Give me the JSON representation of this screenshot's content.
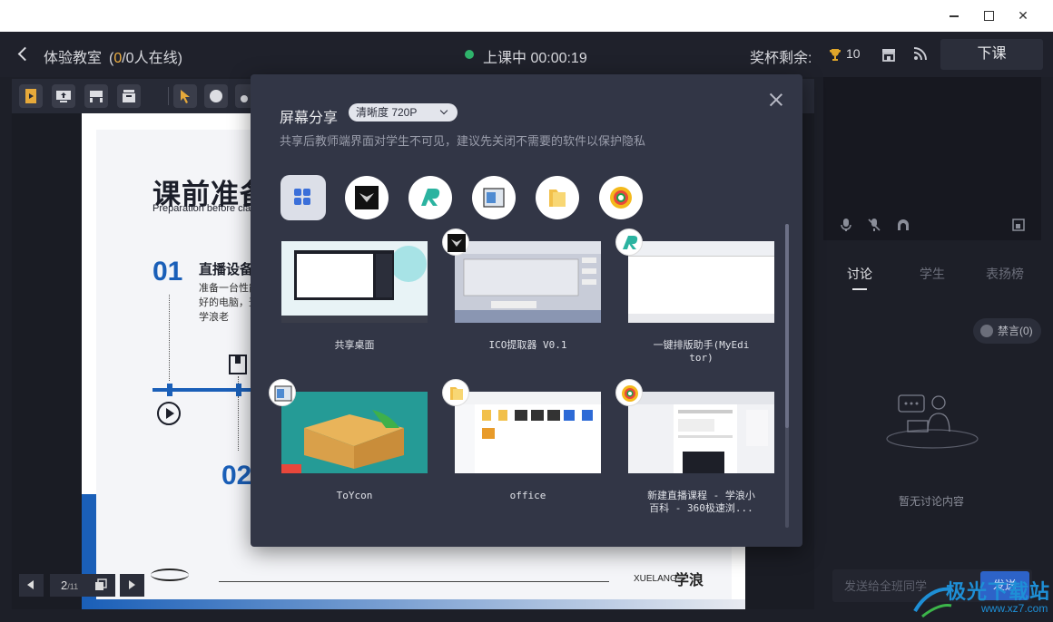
{
  "window": {
    "controls": [
      "minimize",
      "maximize",
      "close"
    ]
  },
  "header": {
    "room_title": "体验教室",
    "online_prefix": "(",
    "online_current": "0",
    "online_suffix": "/0人在线)",
    "status": "上课中 00:00:19",
    "cup_label": "奖杯剩余:",
    "cup_count": "10",
    "end_button": "下课"
  },
  "slide": {
    "title": "课前准备",
    "subtitle": "Preparation before class",
    "num1": "01",
    "item1_title": "直播设备",
    "item1_desc": "准备一台性能较好的电脑，登录学浪老",
    "num2": "02",
    "brand_en": "XUELANG",
    "brand_cn": "学浪"
  },
  "pager": {
    "current": "2",
    "total": "/11"
  },
  "right": {
    "tabs": [
      "讨论",
      "学生",
      "表扬榜"
    ],
    "mute_button": "禁言(0)",
    "empty_text": "暂无讨论内容",
    "input_placeholder": "发送给全班同学",
    "send_button": "发送"
  },
  "watermark": {
    "cn": "极光下载站",
    "en": "www.xz7.com"
  },
  "modal": {
    "title": "屏幕分享",
    "quality": "清晰度 720P",
    "note": "共享后教师端界面对学生不可见，建议先关闭不需要的软件以保护隐私",
    "filters": [
      "all-apps-icon",
      "ico-extractor-icon",
      "myeditor-icon",
      "toycon-icon",
      "folder-icon",
      "browser-360-icon"
    ],
    "windows": [
      {
        "label": "共享桌面"
      },
      {
        "label": "ICO提取器 V0.1"
      },
      {
        "label_l1": "一键排版助手(MyEdi",
        "label_l2": "tor)"
      },
      {
        "label": "ToYcon"
      },
      {
        "label": "office"
      },
      {
        "label_l1": "新建直播课程 - 学浪小",
        "label_l2": "百科 - 360极速浏..."
      }
    ]
  },
  "colors": {
    "accent": "#2d63c8",
    "status": "#2fb36b",
    "highlight": "#f0b042",
    "slide_blue": "#1a5fb8"
  }
}
